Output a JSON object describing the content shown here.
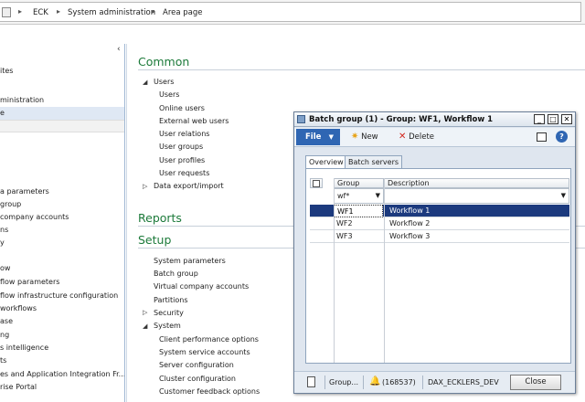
{
  "breadcrumb": {
    "items": [
      "ECK",
      "System administration",
      "Area page"
    ]
  },
  "nav": {
    "items": [
      {
        "label": "ites",
        "selected": false
      },
      {
        "label": "ministration",
        "selected": false
      },
      {
        "label": "e",
        "selected": true
      },
      {
        "label": "a parameters",
        "selected": false
      },
      {
        "label": "group",
        "selected": false
      },
      {
        "label": "company accounts",
        "selected": false
      },
      {
        "label": "ns",
        "selected": false
      },
      {
        "label": "y",
        "selected": false
      },
      {
        "label": "",
        "selected": false
      },
      {
        "label": "ow",
        "selected": false
      },
      {
        "label": "flow parameters",
        "selected": false
      },
      {
        "label": "flow infrastructure configuration",
        "selected": false
      },
      {
        "label": "workflows",
        "selected": false
      },
      {
        "label": "ase",
        "selected": false
      },
      {
        "label": "ng",
        "selected": false
      },
      {
        "label": "s intelligence",
        "selected": false
      },
      {
        "label": "ts",
        "selected": false
      },
      {
        "label": "es and Application Integration Fr...",
        "selected": false
      },
      {
        "label": "rise Portal",
        "selected": false
      }
    ]
  },
  "content": {
    "common_title": "Common",
    "users_group": "Users",
    "users_links": [
      "Users",
      "Online users",
      "External web users",
      "User relations",
      "User groups",
      "User profiles",
      "User requests"
    ],
    "data_export": "Data export/import",
    "reports_title": "Reports",
    "setup_title": "Setup",
    "setup_links": [
      "System parameters",
      "Batch group",
      "Virtual company accounts",
      "Partitions"
    ],
    "security_group": "Security",
    "system_group": "System",
    "system_links": [
      "Client performance options",
      "System service accounts",
      "Server configuration",
      "Cluster configuration",
      "Customer feedback options"
    ]
  },
  "dialog": {
    "title": "Batch group (1) - Group: WF1, Workflow 1",
    "file_label": "File",
    "new_label": "New",
    "delete_label": "Delete",
    "tabs": [
      "Overview",
      "Batch servers"
    ],
    "columns": [
      "Group",
      "Description"
    ],
    "filter_value": "wf*",
    "rows": [
      {
        "group": "WF1",
        "description": "Workflow 1",
        "selected": true
      },
      {
        "group": "WF2",
        "description": "Workflow 2",
        "selected": false
      },
      {
        "group": "WF3",
        "description": "Workflow 3",
        "selected": false
      }
    ],
    "status": {
      "group_label": "Group...",
      "alert_count": "(168537)",
      "server": "DAX_ECKLERS_DEV",
      "close_label": "Close"
    }
  },
  "colors": {
    "section_title": "#1c7a3a",
    "file_button": "#2f66b3",
    "selected_row": "#1c3a7e"
  }
}
